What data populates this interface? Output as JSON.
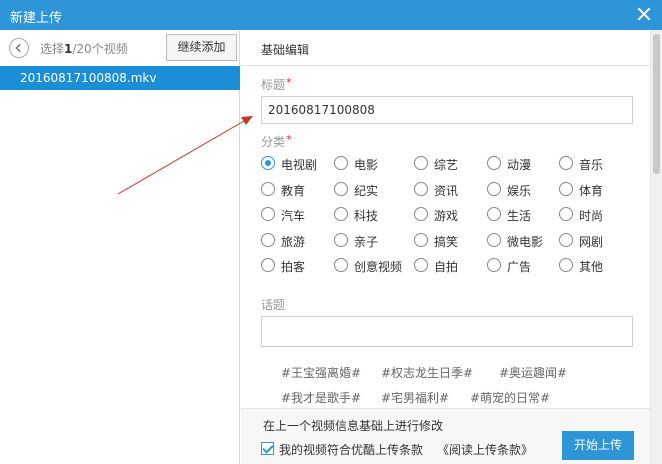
{
  "window": {
    "title": "新建上传"
  },
  "left": {
    "select_prefix": "选择",
    "select_current": "1",
    "select_suffix": "/20个视频",
    "continue_label": "继续添加",
    "files": [
      "20160817100808.mkv"
    ]
  },
  "editor": {
    "section_title": "基础编辑",
    "title_label": "标题",
    "title_value": "20160817100808",
    "category_label": "分类",
    "categories": [
      [
        "电视剧",
        "电影",
        "综艺",
        "动漫",
        "音乐"
      ],
      [
        "教育",
        "纪实",
        "资讯",
        "娱乐",
        "体育"
      ],
      [
        "汽车",
        "科技",
        "游戏",
        "生活",
        "时尚"
      ],
      [
        "旅游",
        "亲子",
        "搞笑",
        "微电影",
        "网剧"
      ],
      [
        "拍客",
        "创意视频",
        "自拍",
        "广告",
        "其他"
      ]
    ],
    "selected_category": "电视剧",
    "topic_label": "话题",
    "topic_tags": [
      [
        "#王宝强离婚#",
        "#权志龙生日季#",
        "#奥运趣闻#"
      ],
      [
        "#我才是歌手#",
        "#宅男福利#",
        "#萌宠的日常#"
      ]
    ]
  },
  "bottom": {
    "modify_text": "在上一个视频信息基础上进行修改",
    "agree_text": "我的视频符合优酷上传条款",
    "terms_link": "《阅读上传条款》",
    "start_label": "开始上传"
  },
  "colors": {
    "accent": "#2d95d8",
    "selected_row": "#1a8fd8",
    "required": "#ee3333",
    "annotation_arrow": "#c0392b"
  }
}
